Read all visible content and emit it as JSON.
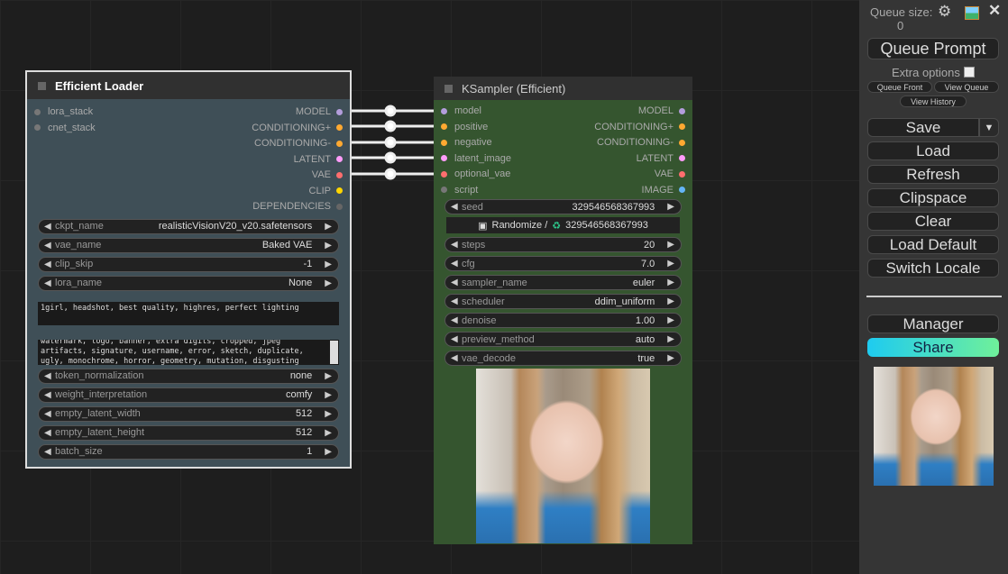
{
  "loader": {
    "title": "Efficient Loader",
    "inputs": [
      {
        "label": "lora_stack",
        "color": "#777777"
      },
      {
        "label": "cnet_stack",
        "color": "#777777"
      }
    ],
    "outputs": [
      {
        "label": "MODEL",
        "color": "#b39ddb"
      },
      {
        "label": "CONDITIONING+",
        "color": "#ffa931"
      },
      {
        "label": "CONDITIONING-",
        "color": "#ffa931"
      },
      {
        "label": "LATENT",
        "color": "#ff9cf9"
      },
      {
        "label": "VAE",
        "color": "#ff6e6e"
      },
      {
        "label": "CLIP",
        "color": "#ffd500"
      },
      {
        "label": "DEPENDENCIES",
        "color": "#666666"
      }
    ],
    "widgets_top": [
      {
        "label": "ckpt_name",
        "value": "realisticVisionV20_v20.safetensors"
      },
      {
        "label": "vae_name",
        "value": "Baked VAE"
      },
      {
        "label": "clip_skip",
        "value": "-1"
      },
      {
        "label": "lora_name",
        "value": "None"
      }
    ],
    "positive_prompt": "1girl, headshot, best quality, highres, perfect lighting",
    "negative_prompt": "watermark, logo, banner, extra digits, cropped, jpeg artifacts, signature, username, error, sketch, duplicate, ugly, monochrome, horror, geometry, mutation, disgusting",
    "widgets_bottom": [
      {
        "label": "token_normalization",
        "value": "none"
      },
      {
        "label": "weight_interpretation",
        "value": "comfy"
      },
      {
        "label": "empty_latent_width",
        "value": "512"
      },
      {
        "label": "empty_latent_height",
        "value": "512"
      },
      {
        "label": "batch_size",
        "value": "1"
      }
    ]
  },
  "sampler": {
    "title": "KSampler (Efficient)",
    "inputs": [
      {
        "label": "model",
        "color": "#b39ddb"
      },
      {
        "label": "positive",
        "color": "#ffa931"
      },
      {
        "label": "negative",
        "color": "#ffa931"
      },
      {
        "label": "latent_image",
        "color": "#ff9cf9"
      },
      {
        "label": "optional_vae",
        "color": "#ff6e6e"
      },
      {
        "label": "script",
        "color": "#777777"
      }
    ],
    "outputs": [
      {
        "label": "MODEL",
        "color": "#b39ddb"
      },
      {
        "label": "CONDITIONING+",
        "color": "#ffa931"
      },
      {
        "label": "CONDITIONING-",
        "color": "#ffa931"
      },
      {
        "label": "LATENT",
        "color": "#ff9cf9"
      },
      {
        "label": "VAE",
        "color": "#ff6e6e"
      },
      {
        "label": "IMAGE",
        "color": "#64b5f6"
      }
    ],
    "seed": {
      "label": "seed",
      "value": "329546568367993"
    },
    "randomize_label": "Randomize /",
    "randomize_value": "329546568367993",
    "widgets": [
      {
        "label": "steps",
        "value": "20"
      },
      {
        "label": "cfg",
        "value": "7.0"
      },
      {
        "label": "sampler_name",
        "value": "euler"
      },
      {
        "label": "scheduler",
        "value": "ddim_uniform"
      },
      {
        "label": "denoise",
        "value": "1.00"
      },
      {
        "label": "preview_method",
        "value": "auto"
      },
      {
        "label": "vae_decode",
        "value": "true"
      }
    ],
    "preview_alt": "generated portrait preview"
  },
  "panel": {
    "queue_size_label": "Queue size:",
    "queue_size_value": "0",
    "queue_prompt": "Queue Prompt",
    "extra_options": "Extra options",
    "queue_front": "Queue Front",
    "view_queue": "View Queue",
    "view_history": "View History",
    "save": "Save",
    "load": "Load",
    "refresh": "Refresh",
    "clipspace": "Clipspace",
    "clear": "Clear",
    "load_default": "Load Default",
    "switch_locale": "Switch Locale",
    "manager": "Manager",
    "share": "Share"
  }
}
